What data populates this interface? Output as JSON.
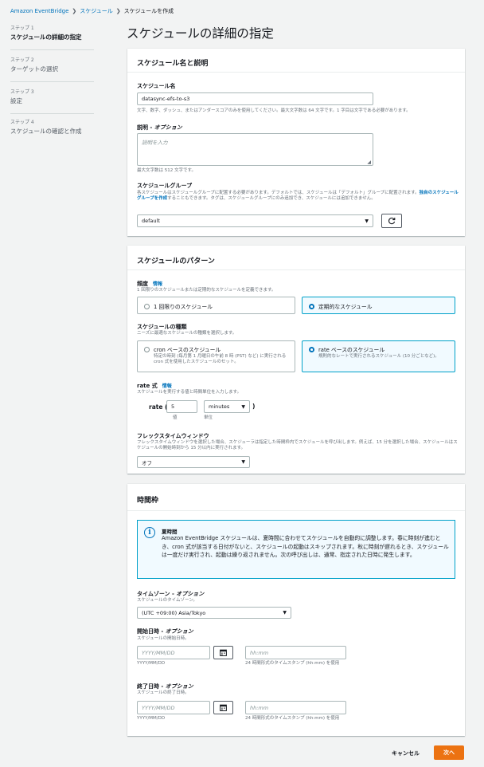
{
  "breadcrumb": {
    "items": [
      "Amazon EventBridge",
      "スケジュール",
      "スケジュールを作成"
    ]
  },
  "sidebar": {
    "steps": [
      {
        "step": "ステップ 1",
        "name": "スケジュールの詳細の指定",
        "active": true
      },
      {
        "step": "ステップ 2",
        "name": "ターゲットの選択",
        "active": false
      },
      {
        "step": "ステップ 3",
        "name": "設定",
        "active": false
      },
      {
        "step": "ステップ 4",
        "name": "スケジュールの確認と作成",
        "active": false
      }
    ]
  },
  "page": {
    "title": "スケジュールの詳細の指定"
  },
  "name_section": {
    "heading": "スケジュール名と説明",
    "name_label": "スケジュール名",
    "name_value": "datasync-efs-to-s3",
    "name_hint": "文字、数字、ダッシュ、またはアンダースコアのみを使用してください。最大文字数は 64 文字です。1 字目は文字である必要があります。",
    "desc_label": "説明 - ",
    "desc_label_opt": "オプション",
    "desc_placeholder": "説明を入力",
    "desc_hint": "最大文字数は 512 文字です。",
    "group_label": "スケジュールグループ",
    "group_desc_1": "各スケジュールはスケジュールグループに配置する必要があります。デフォルトでは、スケジュールは「デフォルト」グループに配置されます。",
    "group_desc_link": "独自のスケジュールグループを作成",
    "group_desc_2": "することもできます。タグは、スケジュールグループにのみ追加でき、スケジュールには追加できません。",
    "group_value": "default"
  },
  "pattern_section": {
    "heading": "スケジュールのパターン",
    "freq_label": "頻度",
    "info": "情報",
    "freq_desc": "1 回限りのスケジュールまたは定期的なスケジュールを定義できます。",
    "one_time": "1 回限りのスケジュール",
    "recurring": "定期的なスケジュール",
    "type_label": "スケジュールの種類",
    "type_desc": "ニーズに最適なスケジュールの種類を選択します。",
    "cron_title": "cron ベースのスケジュール",
    "cron_desc": "特定の時刻 (毎月第 1 月曜日の午前 8 時 (PST) など) に実行される cron 式を使用したスケジュールのセット。",
    "rate_title": "rate ベースのスケジュール",
    "rate_desc": "規則的なレートで実行されるスケジュール (10 分ごとなど)。",
    "rate_label": "rate 式",
    "rate_desc2": "スケジュールを実行する値と時間単位を入力します。",
    "rate_open": "rate (",
    "rate_value": "5",
    "rate_unit": "minutes",
    "rate_close": ")",
    "value_caption": "値",
    "unit_caption": "単位",
    "flex_label": "フレックスタイムウィンドウ",
    "flex_desc": "フレックスタイムウィンドウを選択した場合、スケジューラは指定した時間枠内でスケジュールを呼び出します。例えば、15 分を選択した場合、スケジュールはスケジュールの開始時刻から 15 分以内に実行されます。",
    "flex_value": "オフ"
  },
  "time_section": {
    "heading": "時間枠",
    "alert_title": "夏時間",
    "alert_body": "Amazon EventBridge スケジュールは、夏時間に合わせてスケジュールを自動的に調整します。春に時刻が進むとき、cron 式が該当する日付がないと、スケジュールの起動はスキップされます。秋に時刻が遅れるとき、スケジュールは一度だけ実行され、起動は繰り返されません。次の呼び出しは、通常、指定された日時に発生します。",
    "tz_label": "タイムゾーン - ",
    "tz_label_opt": "オプション",
    "tz_desc": "スケジュールのタイムゾーン。",
    "tz_value": "(UTC +09:00) Asia/Tokyo",
    "start_label": "開始日時 - ",
    "start_label_opt": "オプション",
    "start_desc": "スケジュールの開始日時。",
    "end_label": "終了日時 - ",
    "end_label_opt": "オプション",
    "end_desc": "スケジュールの終了日時。",
    "date_placeholder": "YYYY/MM/DD",
    "date_caption": "YYYY/MM/DD",
    "time_placeholder": "hh:mm",
    "time_caption": "24 時間形式のタイムスタンプ (hh:mm) を使用"
  },
  "footer": {
    "cancel": "キャンセル",
    "next": "次へ"
  },
  "colors": {
    "primary": "#ec7211",
    "link": "#0073bb",
    "selected": "#00a1c9"
  }
}
